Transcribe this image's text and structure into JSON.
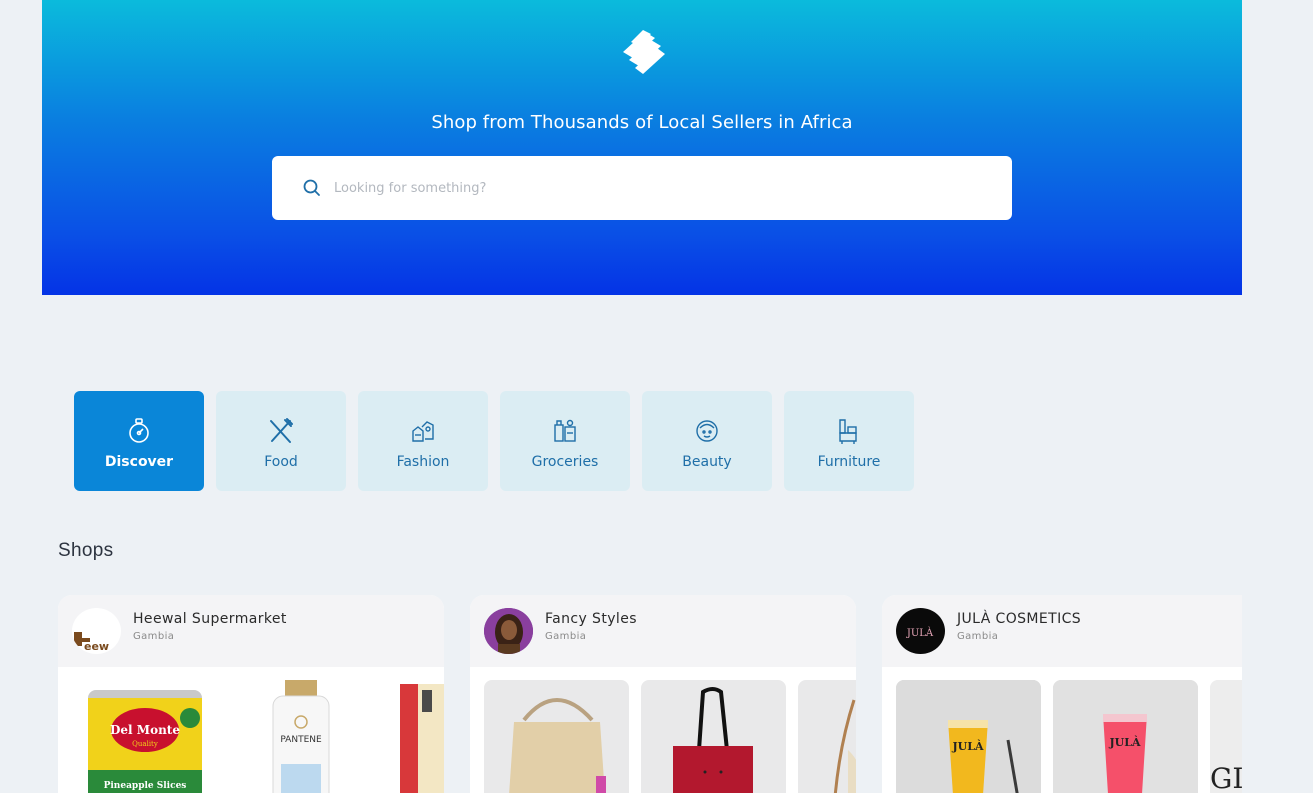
{
  "hero": {
    "tagline": "Shop from Thousands of Local Sellers in Africa",
    "logo_icon": "brand-stripes-logo"
  },
  "search": {
    "placeholder": "Looking for something?",
    "value": "",
    "icon": "search-icon"
  },
  "categories": [
    {
      "label": "Discover",
      "icon": "stopwatch-icon",
      "active": true
    },
    {
      "label": "Food",
      "icon": "fork-knife-icon",
      "active": false
    },
    {
      "label": "Fashion",
      "icon": "clothes-icon",
      "active": false
    },
    {
      "label": "Groceries",
      "icon": "grocery-icon",
      "active": false
    },
    {
      "label": "Beauty",
      "icon": "face-icon",
      "active": false
    },
    {
      "label": "Furniture",
      "icon": "furniture-icon",
      "active": false
    }
  ],
  "shops_section": {
    "title": "Shops"
  },
  "shops": [
    {
      "name": "Heewal Supermarket",
      "country": "Gambia",
      "logo_text": "eew"
    },
    {
      "name": "Fancy Styles",
      "country": "Gambia"
    },
    {
      "name": "JULÀ COSMETICS",
      "country": "Gambia",
      "logo_text": "JULÀ"
    }
  ],
  "products": {
    "can_brand": "Del Monte",
    "can_quality": "Quality",
    "can_product": "Pineapple Slices",
    "bottle_brand": "PANTENE",
    "tube_brand_1": "JULÀ",
    "tube_brand_2": "JULÀ",
    "partial_text": "GI"
  },
  "colors": {
    "hero_top": "#0bbbdc",
    "hero_bottom": "#0433e6",
    "accent": "#0a86d8",
    "category_bg": "#dbedf3",
    "page_bg": "#edf1f5"
  }
}
